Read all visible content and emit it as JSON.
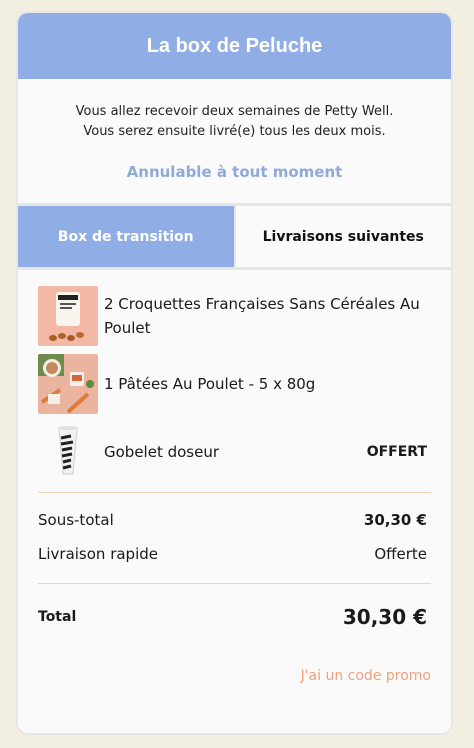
{
  "header": {
    "title": "La box de Peluche"
  },
  "intro": {
    "line1": "Vous allez recevoir deux semaines de Petty Well.",
    "line2": "Vous serez ensuite livré(e) tous les deux mois.",
    "cancel": "Annulable à tout moment"
  },
  "tabs": [
    {
      "label": "Box de transition",
      "active": true
    },
    {
      "label": "Livraisons suivantes",
      "active": false
    }
  ],
  "items": [
    {
      "label": "2 Croquettes Françaises Sans Céréales Au Poulet",
      "price": ""
    },
    {
      "label": "1 Pâtées Au Poulet - 5 x 80g",
      "price": ""
    },
    {
      "label": "Gobelet doseur",
      "price": "OFFERT"
    }
  ],
  "summary": {
    "subtotal_label": "Sous-total",
    "subtotal_value": "30,30 €",
    "shipping_label": "Livraison rapide",
    "shipping_value": "Offerte",
    "total_label": "Total",
    "total_value": "30,30 €"
  },
  "promo": {
    "label": "J'ai un code promo"
  },
  "colors": {
    "accent": "#90aee5",
    "promo": "#f0a07c",
    "background": "#f3efe0"
  }
}
